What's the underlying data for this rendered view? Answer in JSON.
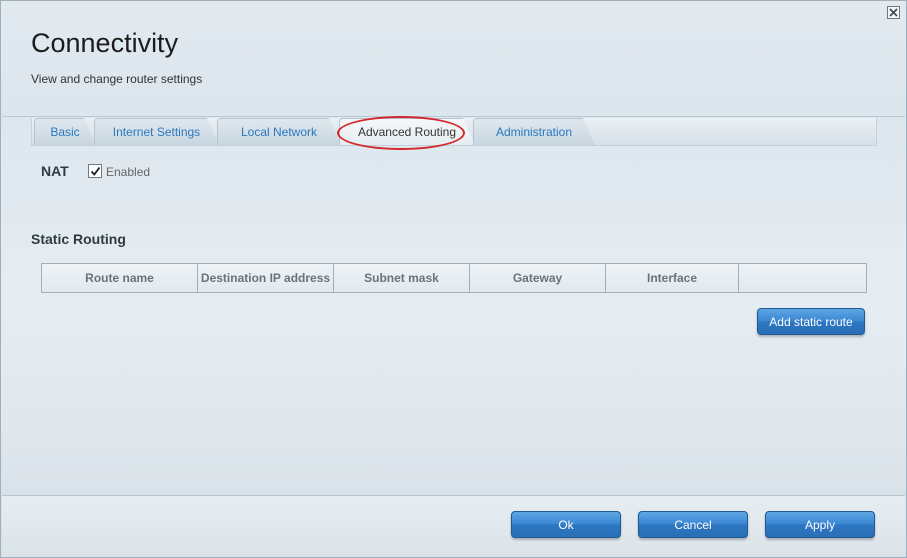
{
  "window": {
    "title": "Connectivity",
    "subtitle": "View and change router settings",
    "close_icon": "close-icon"
  },
  "tabs": [
    {
      "label": "Basic",
      "active": false
    },
    {
      "label": "Internet Settings",
      "active": false
    },
    {
      "label": "Local Network",
      "active": false
    },
    {
      "label": "Advanced Routing",
      "active": true
    },
    {
      "label": "Administration",
      "active": false
    }
  ],
  "nat": {
    "label": "NAT",
    "checkbox_label": "Enabled",
    "checked": true
  },
  "static_routing": {
    "title": "Static Routing",
    "columns": [
      "Route name",
      "Destination IP address",
      "Subnet mask",
      "Gateway",
      "Interface",
      ""
    ],
    "add_button": "Add static route"
  },
  "footer": {
    "ok": "Ok",
    "cancel": "Cancel",
    "apply": "Apply"
  },
  "colors": {
    "accent": "#2a79bd",
    "highlight": "#d4282d"
  }
}
